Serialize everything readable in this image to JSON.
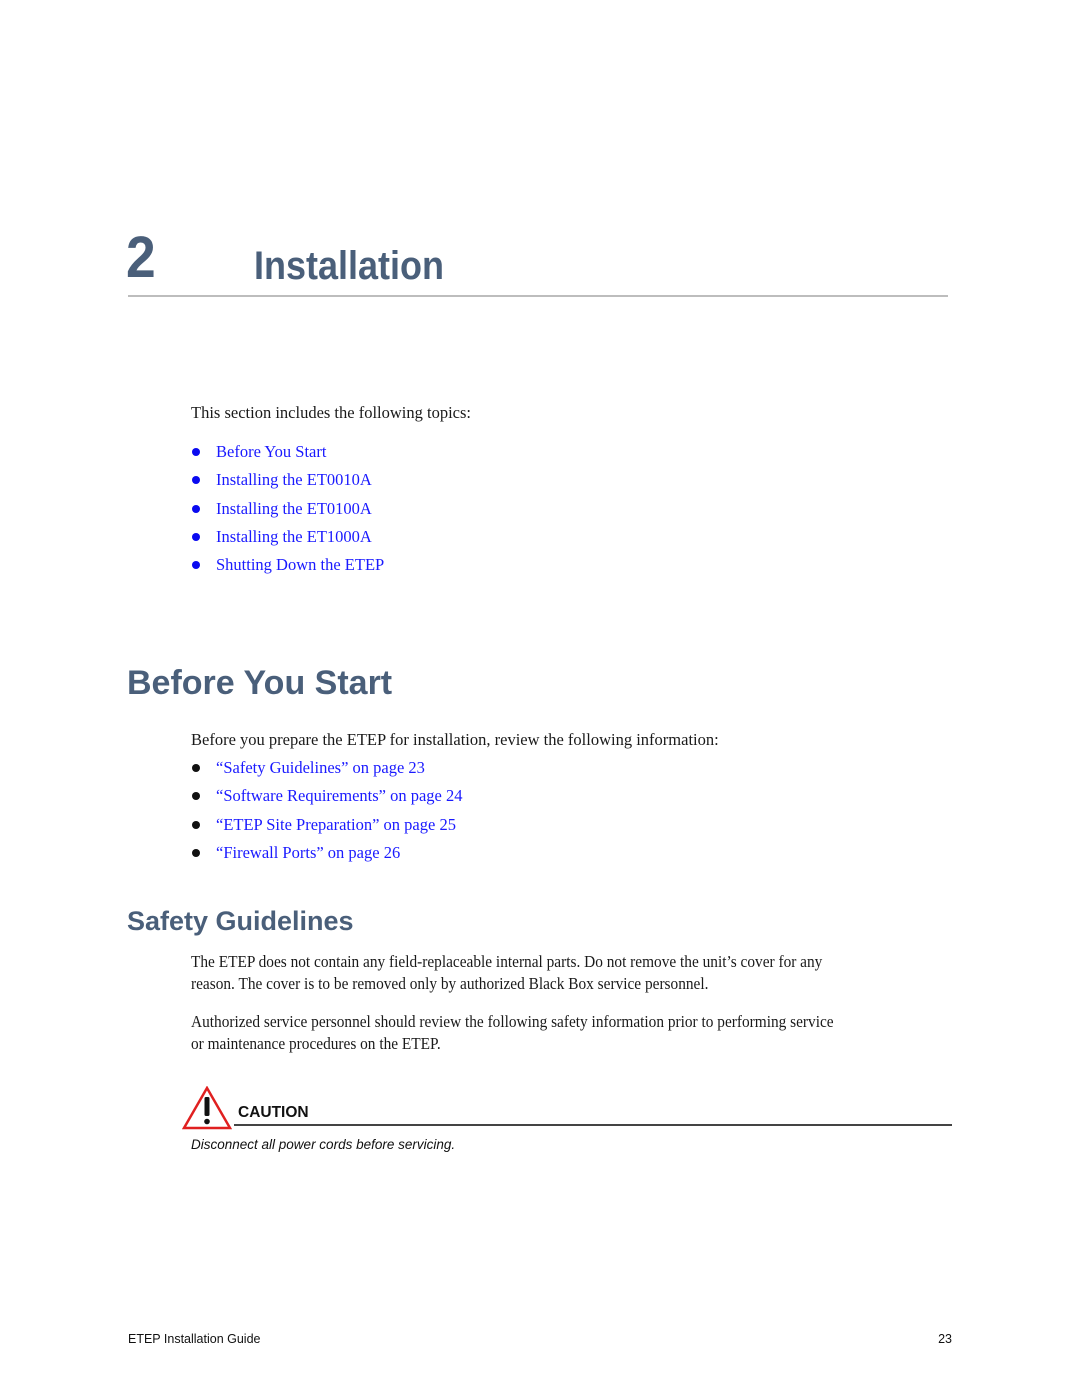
{
  "chapter": {
    "number": "2",
    "title": "Installation"
  },
  "intro": {
    "text": "This section includes the following topics:",
    "topics": [
      {
        "label": "Before You Start"
      },
      {
        "label": "Installing the ET0010A"
      },
      {
        "label": "Installing the ET0100A"
      },
      {
        "label": "Installing the ET1000A"
      },
      {
        "label": "Shutting Down the ETEP"
      }
    ]
  },
  "before_you_start": {
    "heading": "Before You Start",
    "text": "Before you prepare the ETEP for installation, review the following information:",
    "links": [
      {
        "label": "“Safety Guidelines” on page 23"
      },
      {
        "label": "“Software Requirements” on page 24"
      },
      {
        "label": "“ETEP Site Preparation” on page 25"
      },
      {
        "label": "“Firewall Ports” on page 26"
      }
    ]
  },
  "safety_guidelines": {
    "heading": "Safety Guidelines",
    "paragraph1": [
      "The ETEP does not contain any field-replaceable internal parts. Do not remove the unit’s cover for any",
      "reason. The cover is to be removed only by authorized Black Box service personnel."
    ],
    "paragraph2": [
      "Authorized service personnel should review the following safety information prior to performing service",
      "or maintenance procedures on the ETEP."
    ],
    "caution": {
      "icon": "warning-triangle-icon",
      "label": "CAUTION",
      "text": "Disconnect all power cords before servicing."
    }
  },
  "footer": {
    "title": "ETEP Installation Guide",
    "page_number": "23"
  },
  "colors": {
    "heading": "#4a5f7a",
    "link": "#1a1aff",
    "caution_triangle": "#e02020"
  }
}
